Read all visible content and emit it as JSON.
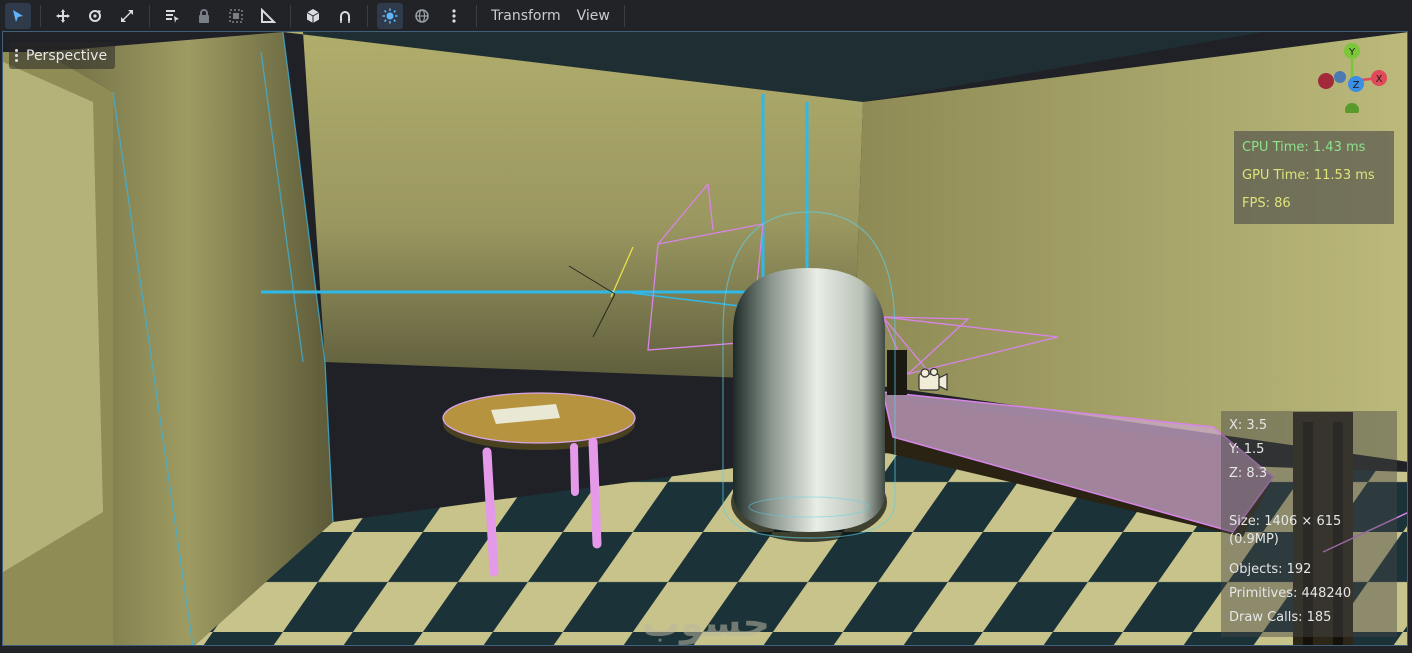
{
  "toolbar": {
    "tools": [
      {
        "icon": "select-arrow-icon",
        "active": true
      },
      {
        "icon": "move-icon",
        "active": false
      },
      {
        "icon": "rotate-icon",
        "active": false
      },
      {
        "icon": "scale-icon",
        "active": false
      },
      {
        "icon": "list-select-icon",
        "active": false
      },
      {
        "icon": "lock-icon",
        "active": false
      },
      {
        "icon": "group-icon",
        "active": false
      },
      {
        "icon": "ruler-icon",
        "active": false
      },
      {
        "icon": "local-space-icon",
        "active": false
      },
      {
        "icon": "snap-icon",
        "active": false
      },
      {
        "icon": "sun-preview-icon",
        "active": true
      },
      {
        "icon": "environment-preview-icon",
        "active": false
      },
      {
        "icon": "more-options-icon",
        "active": false
      }
    ],
    "menus": [
      "Transform",
      "View"
    ]
  },
  "viewport": {
    "mode_label": "Perspective",
    "stats": {
      "cpu": "CPU Time: 1.43 ms",
      "gpu": "GPU Time: 11.53 ms",
      "fps": "FPS: 86"
    },
    "info": {
      "x": "X: 3.5",
      "y": "Y: 1.5",
      "z": "Z: 8.3",
      "size": "Size: 1406 × 615 (0.9MP)",
      "objects": "Objects: 192",
      "primitives": "Primitives: 448240",
      "draw_calls": "Draw Calls: 185"
    },
    "gizmo": {
      "y": "Y",
      "x": "X",
      "z": "Z"
    },
    "watermark": "حسوب"
  },
  "colors": {
    "accent": "#3fa8ff",
    "cpu_text": "#8de28a",
    "gpu_text": "#e0e27a",
    "wall": "#a8a664",
    "floor_light": "#c8c48a",
    "floor_dark": "#1a3036",
    "gizmo_x": "#e04a5a",
    "gizmo_y": "#7ac83a",
    "gizmo_z": "#3a8ee6"
  }
}
